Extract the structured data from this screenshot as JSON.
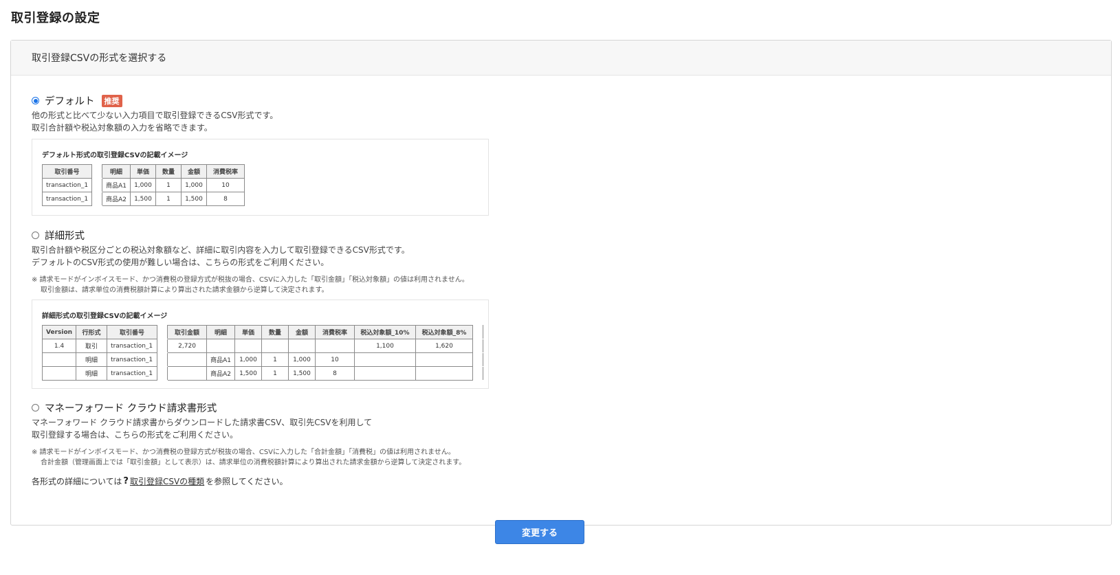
{
  "page_title": "取引登録の設定",
  "card_title": "取引登録CSVの形式を選択する",
  "options": [
    {
      "label": "デフォルト",
      "badge": "推奨",
      "selected": true,
      "desc1": "他の形式と比べて少ない入力項目で取引登録できるCSV形式です。",
      "desc2": "取引合計額や税込対象額の入力を省略できます。",
      "sample_title": "デフォルト形式の取引登録CSVの記載イメージ",
      "table": {
        "headers": [
          "取引番号",
          "明細",
          "単価",
          "数量",
          "金額",
          "消費税率"
        ],
        "rows": [
          [
            "transaction_1",
            "商品A1",
            "1,000",
            "1",
            "1,000",
            "10"
          ],
          [
            "transaction_1",
            "商品A2",
            "1,500",
            "1",
            "1,500",
            "8"
          ]
        ]
      }
    },
    {
      "label": "詳細形式",
      "selected": false,
      "desc1": "取引合計額や税区分ごとの税込対象額など、詳細に取引内容を入力して取引登録できるCSV形式です。",
      "desc2": "デフォルトのCSV形式の使用が難しい場合は、こちらの形式をご利用ください。",
      "note1": "※ 請求モードがインボイスモード、かつ消費税の登録方式が税抜の場合、CSVに入力した「取引金額」「税込対象額」の値は利用されません。",
      "note2": "取引金額は、請求単位の消費税額計算により算出された請求金額から逆算して決定されます。",
      "sample_title": "詳細形式の取引登録CSVの記載イメージ",
      "table": {
        "headers": [
          "Version",
          "行形式",
          "取引番号",
          "取引金額",
          "明細",
          "単価",
          "数量",
          "金額",
          "消費税率",
          "税込対象額_10%",
          "税込対象額_8%"
        ],
        "rows": [
          [
            "1.4",
            "取引",
            "transaction_1",
            "2,720",
            "",
            "",
            "",
            "",
            "",
            "1,100",
            "1,620"
          ],
          [
            "",
            "明細",
            "transaction_1",
            "",
            "商品A1",
            "1,000",
            "1",
            "1,000",
            "10",
            "",
            ""
          ],
          [
            "",
            "明細",
            "transaction_1",
            "",
            "商品A2",
            "1,500",
            "1",
            "1,500",
            "8",
            "",
            ""
          ]
        ]
      }
    },
    {
      "label": "マネーフォワード クラウド請求書形式",
      "selected": false,
      "desc1": "マネーフォワード クラウド請求書からダウンロードした請求書CSV、取引先CSVを利用して",
      "desc2": "取引登録する場合は、こちらの形式をご利用ください。",
      "note1": "※ 請求モードがインボイスモード、かつ消費税の登録方式が税抜の場合、CSVに入力した「合計金額」「消費税」の値は利用されません。",
      "note2": "合計金額（管理画面上では「取引金額」として表示）は、請求単位の消費税額計算により算出された請求金額から逆算して決定されます。"
    }
  ],
  "footer": {
    "prefix": "各形式の詳細については",
    "link": "取引登録CSVの種類",
    "suffix": "を参照してください。"
  },
  "submit_label": "変更する",
  "colors": {
    "primary": "#3d86e6",
    "badge": "#e0624a"
  }
}
